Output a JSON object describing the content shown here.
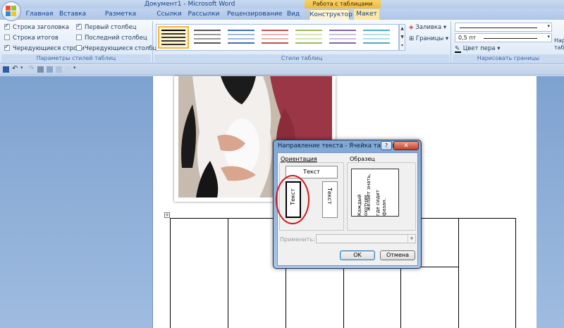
{
  "window": {
    "title": "Документ1 - Microsoft Word",
    "context_title": "Работа с таблицами"
  },
  "tabs": [
    {
      "label": "Главная"
    },
    {
      "label": "Вставка"
    },
    {
      "label": "Разметка страницы"
    },
    {
      "label": "Ссылки"
    },
    {
      "label": "Рассылки"
    },
    {
      "label": "Рецензирование"
    },
    {
      "label": "Вид"
    },
    {
      "label": "Конструктор",
      "active": true
    },
    {
      "label": "Макет"
    }
  ],
  "ribbon": {
    "style_options": {
      "label": "Параметры стилей таблиц",
      "items": [
        {
          "label": "Строка заголовка",
          "checked": true
        },
        {
          "label": "Строка итогов",
          "checked": false
        },
        {
          "label": "Чередующиеся строки",
          "checked": true
        },
        {
          "label": "Первый столбец",
          "checked": true
        },
        {
          "label": "Последний столбец",
          "checked": false
        },
        {
          "label": "Чередующиеся столбцы",
          "checked": false
        }
      ]
    },
    "table_styles": {
      "label": "Стили таблиц",
      "fill": "Заливка",
      "borders": "Границы"
    },
    "draw_borders": {
      "label": "Нарисовать границы",
      "pen_weight": "0,5 пт",
      "pen_color": "Цвет пера",
      "draw_table": "Нари",
      "draw_table_2": "табл"
    }
  },
  "dialog": {
    "title": "Направление текста - Ячейка таблицы",
    "help": "?",
    "close": "✕",
    "orientation_label": "Ориентация",
    "sample_label": "Образец",
    "option_horizontal": "Текст",
    "option_up": "Текст",
    "option_down": "Текст",
    "sample_lines": [
      "Каждый охотник",
      "желает знать,",
      "где сидит фазан."
    ],
    "apply_label": "Применить:",
    "ok": "OK",
    "cancel": "Отмена"
  },
  "colors": {
    "accent_ribbon": "#dbe7f6",
    "context_tab": "#f0b93d",
    "highlight_ring": "#d01818"
  }
}
